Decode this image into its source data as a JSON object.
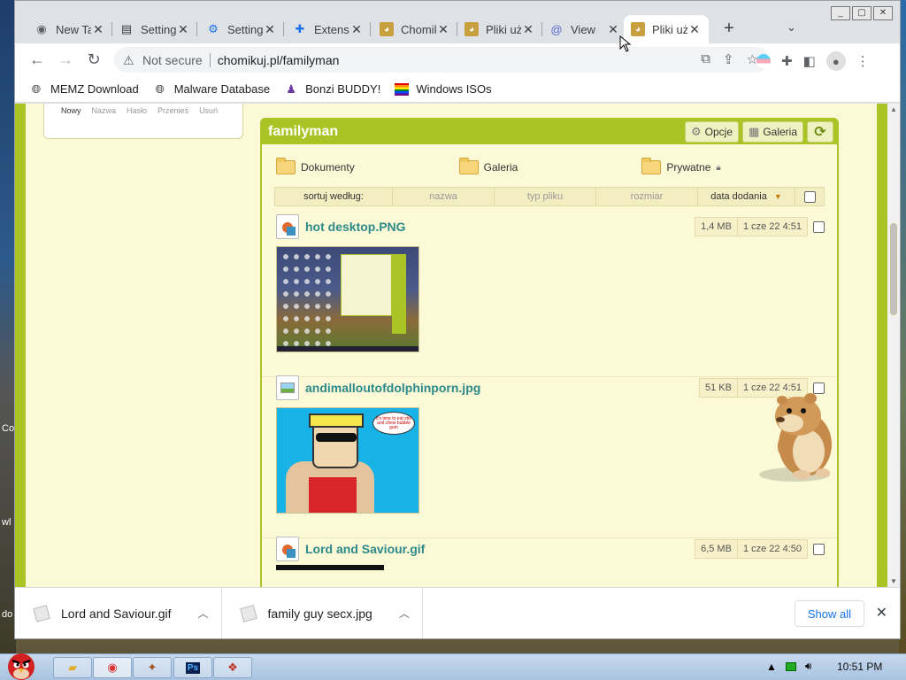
{
  "browser": {
    "tabs": [
      {
        "label": "New Tab",
        "icon": "chrome-icon"
      },
      {
        "label": "Settings",
        "icon": "settings-doc-icon"
      },
      {
        "label": "Settings",
        "icon": "gear-icon"
      },
      {
        "label": "Extensions",
        "icon": "puzzle-icon"
      },
      {
        "label": "Chomikuj",
        "icon": "hamster-icon"
      },
      {
        "label": "Pliki użytkownika",
        "icon": "hamster-icon"
      },
      {
        "label": "View",
        "icon": "at-icon"
      },
      {
        "label": "Pliki użytkownika",
        "icon": "hamster-icon"
      }
    ],
    "not_secure": "Not secure",
    "url": "chomikuj.pl/familyman",
    "bookmarks": [
      {
        "label": "MEMZ Download",
        "icon": "globe-icon"
      },
      {
        "label": "Malware Database",
        "icon": "globe-icon"
      },
      {
        "label": "Bonzi BUDDY!",
        "icon": "bonzi-icon"
      },
      {
        "label": "Windows ISOs",
        "icon": "rainbow-flag-icon"
      }
    ]
  },
  "sidebar_box": {
    "items": [
      "Nowy",
      "Nazwa",
      "Hasło",
      "Przenieś",
      "Usuń"
    ]
  },
  "panel": {
    "title": "familyman",
    "options_label": "Opcje",
    "gallery_label": "Galeria",
    "folders": [
      {
        "label": "Dokumenty",
        "locked": false
      },
      {
        "label": "Galeria",
        "locked": false
      },
      {
        "label": "Prywatne",
        "locked": true
      }
    ],
    "sort": {
      "label": "sortuj według:",
      "columns": [
        "nazwa",
        "typ pliku",
        "rozmiar",
        "data dodania"
      ]
    },
    "files": [
      {
        "name": "hot desktop.PNG",
        "size": "1,4 MB",
        "date": "1 cze 22 4:51"
      },
      {
        "name": "andimalloutofdolphinporn.jpg",
        "size": "51 KB",
        "date": "1 cze 22 4:51"
      },
      {
        "name": "Lord and Saviour.gif",
        "size": "6,5 MB",
        "date": "1 cze 22 4:50"
      }
    ],
    "bubble_text": "it's time to eat shit and chew bubble gum"
  },
  "downloads": {
    "items": [
      "Lord and Saviour.gif",
      "family guy secx.jpg"
    ],
    "show_all": "Show all"
  },
  "desktop": {
    "left_fragments": [
      "Co",
      "wl",
      "do"
    ]
  },
  "taskbar": {
    "clock": "10:51 PM"
  },
  "colors": {
    "site_green": "#a9c424",
    "page_bg": "#fcf9d7",
    "file_name": "#2c8a8a",
    "link_blue": "#1a73e8"
  }
}
